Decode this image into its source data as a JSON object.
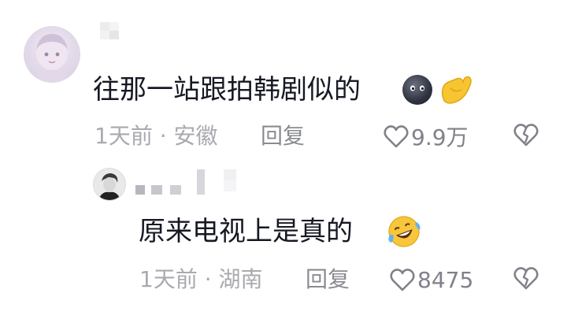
{
  "comment": {
    "text": "往那一站跟拍韩剧似的",
    "time": "1天前",
    "separator": "·",
    "location": "安徽",
    "reply_label": "回复",
    "likes": "9.9万",
    "emojis": [
      "black-moon-face",
      "flexed-biceps"
    ]
  },
  "reply": {
    "text": "原来电视上是真的",
    "time": "1天前",
    "separator": "·",
    "location": "湖南",
    "reply_label": "回复",
    "likes": "8475",
    "emojis": [
      "rolling-on-floor-laughing"
    ]
  }
}
